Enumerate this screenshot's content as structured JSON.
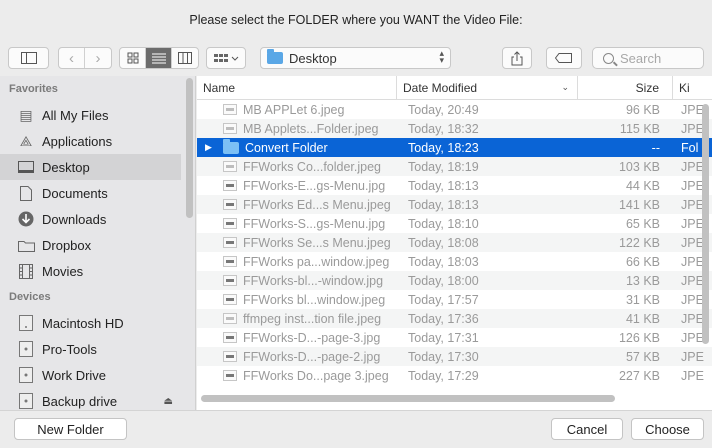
{
  "window": {
    "title": "Please select the FOLDER where you WANT the Video File:"
  },
  "toolbar": {
    "location": "Desktop",
    "search_placeholder": "Search",
    "view_modes": [
      "icon-view",
      "list-view",
      "column-view"
    ],
    "active_view": "list-view"
  },
  "sidebar": {
    "favorites_header": "Favorites",
    "favorites": [
      {
        "label": "All My Files",
        "icon": "all-files-icon"
      },
      {
        "label": "Applications",
        "icon": "applications-icon"
      },
      {
        "label": "Desktop",
        "icon": "desktop-icon",
        "selected": true
      },
      {
        "label": "Documents",
        "icon": "documents-icon"
      },
      {
        "label": "Downloads",
        "icon": "downloads-icon"
      },
      {
        "label": "Dropbox",
        "icon": "folder-icon"
      },
      {
        "label": "Movies",
        "icon": "movies-icon"
      }
    ],
    "devices_header": "Devices",
    "devices": [
      {
        "label": "Macintosh HD",
        "icon": "drive-icon"
      },
      {
        "label": "Pro-Tools",
        "icon": "drive-icon"
      },
      {
        "label": "Work Drive",
        "icon": "drive-icon"
      },
      {
        "label": "Backup drive",
        "icon": "drive-icon",
        "eject": true
      }
    ]
  },
  "filelist": {
    "columns": {
      "name": "Name",
      "date": "Date Modified",
      "size": "Size",
      "kind": "Ki"
    },
    "rows": [
      {
        "name": "MB APPLet 6.jpeg",
        "date": "Today, 20:49",
        "size": "96 KB",
        "kind": "JPE"
      },
      {
        "name": "MB Applets...Folder.jpeg",
        "date": "Today, 18:32",
        "size": "115 KB",
        "kind": "JPE"
      },
      {
        "name": "Convert Folder",
        "date": "Today, 18:23",
        "size": "--",
        "kind": "Fol",
        "folder": true,
        "selected": true
      },
      {
        "name": "FFWorks Co...folder.jpeg",
        "date": "Today, 18:19",
        "size": "103 KB",
        "kind": "JPE"
      },
      {
        "name": "FFWorks-E...gs-Menu.jpg",
        "date": "Today, 18:13",
        "size": "44 KB",
        "kind": "JPE",
        "dark": true
      },
      {
        "name": "FFWorks Ed...s Menu.jpeg",
        "date": "Today, 18:13",
        "size": "141 KB",
        "kind": "JPE",
        "dark": true
      },
      {
        "name": "FFWorks-S...gs-Menu.jpg",
        "date": "Today, 18:10",
        "size": "65 KB",
        "kind": "JPE",
        "dark": true
      },
      {
        "name": "FFWorks Se...s Menu.jpeg",
        "date": "Today, 18:08",
        "size": "122 KB",
        "kind": "JPE",
        "dark": true
      },
      {
        "name": "FFWorks pa...window.jpeg",
        "date": "Today, 18:03",
        "size": "66 KB",
        "kind": "JPE",
        "dark": true
      },
      {
        "name": "FFWorks-bl...-window.jpg",
        "date": "Today, 18:00",
        "size": "13 KB",
        "kind": "JPE",
        "dark": true
      },
      {
        "name": "FFWorks bl...window.jpeg",
        "date": "Today, 17:57",
        "size": "31 KB",
        "kind": "JPE",
        "dark": true
      },
      {
        "name": "ffmpeg inst...tion file.jpeg",
        "date": "Today, 17:36",
        "size": "41 KB",
        "kind": "JPE"
      },
      {
        "name": "FFWorks-D...-page-3.jpg",
        "date": "Today, 17:31",
        "size": "126 KB",
        "kind": "JPE",
        "dark": true
      },
      {
        "name": "FFWorks-D...-page-2.jpg",
        "date": "Today, 17:30",
        "size": "57 KB",
        "kind": "JPE",
        "dark": true
      },
      {
        "name": "FFWorks Do...page 3.jpeg",
        "date": "Today, 17:29",
        "size": "227 KB",
        "kind": "JPE",
        "dark": true
      }
    ]
  },
  "footer": {
    "new_folder": "New Folder",
    "cancel": "Cancel",
    "choose": "Choose"
  }
}
